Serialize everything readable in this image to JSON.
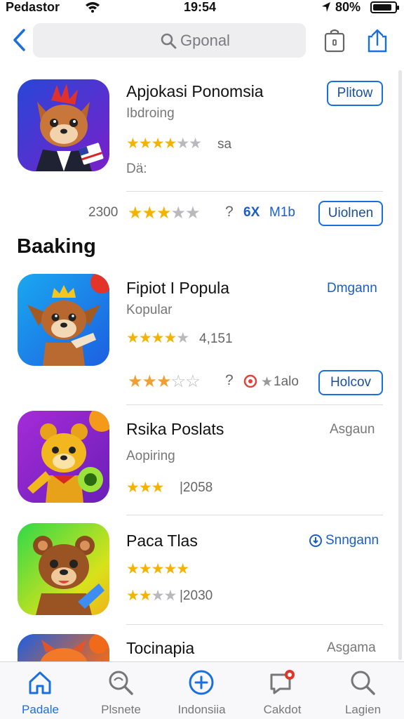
{
  "status_bar": {
    "carrier": "Pedastor",
    "time": "19:54",
    "battery": "80%"
  },
  "search": {
    "placeholder": "Gponal",
    "value": ""
  },
  "section_title": "Baaking",
  "apps": [
    {
      "name": "Apjokasi Ponomsia",
      "subtitle": "Ibdroing",
      "stars": 4,
      "rating": "sa",
      "extra": "Dä:",
      "button": "Plitow",
      "secondary": {
        "count": "2300",
        "stars": 3,
        "mid": "?",
        "badge": "6X",
        "size": "M1b",
        "button": "Uiolnen"
      }
    },
    {
      "name": "Fipiot I Popula",
      "subtitle": "Kopular",
      "stars": 4,
      "rating": "4,151",
      "link": "Dmgann",
      "secondary": {
        "stars": 3,
        "mid": "?",
        "tail": "1alo",
        "button": "Holcov"
      }
    },
    {
      "name": "Rsika Poslats",
      "subtitle": "Aopiring",
      "stars": 3,
      "rating": "|2058",
      "side": "Asgaun"
    },
    {
      "name": "Paca Tlas",
      "stars_line1": 5,
      "stars_line2": 2,
      "rating": "|2030",
      "link": "Snngann"
    },
    {
      "name": "Tocinapia",
      "side": "Asgama"
    }
  ],
  "tab_bar": [
    {
      "label": "Padale",
      "icon": "home-icon",
      "active": true
    },
    {
      "label": "Plsnete",
      "icon": "search-icon"
    },
    {
      "label": "Indonsiia",
      "icon": "plus-circle-icon"
    },
    {
      "label": "Cakdot",
      "icon": "chat-icon",
      "badge": true
    },
    {
      "label": "Lagien",
      "icon": "search-icon"
    }
  ],
  "colors": {
    "accent": "#1a6fe0",
    "star": "#f5b301",
    "star_empty": "#b8b8bd"
  }
}
